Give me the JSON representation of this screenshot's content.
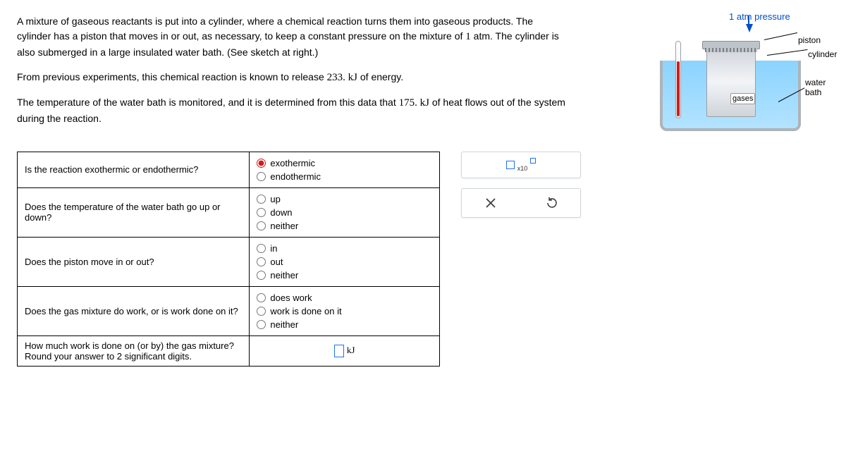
{
  "problem": {
    "p1_a": "A mixture of gaseous reactants is put into a cylinder, where a chemical reaction turns them into gaseous products. The cylinder has a piston that moves in or out, as necessary, to keep a constant pressure on the mixture of ",
    "p1_num": "1",
    "p1_b": " atm. The cylinder is also submerged in a large insulated water bath. (See sketch at right.)",
    "p2_a": "From previous experiments, this chemical reaction is known to release ",
    "p2_num": "233. kJ",
    "p2_b": " of energy.",
    "p3_a": "The temperature of the water bath is monitored, and it is determined from this data that ",
    "p3_num": "175. kJ",
    "p3_b": " of heat flows out of the system during the reaction."
  },
  "sketch_labels": {
    "atm": "1 atm pressure",
    "piston": "piston",
    "cylinder": "cylinder",
    "water_bath": "water bath",
    "gases": "gases"
  },
  "questions": {
    "q1": "Is the reaction exothermic or endothermic?",
    "q1_opts": {
      "a": "exothermic",
      "b": "endothermic"
    },
    "q2": "Does the temperature of the water bath go up or down?",
    "q2_opts": {
      "a": "up",
      "b": "down",
      "c": "neither"
    },
    "q3": "Does the piston move in or out?",
    "q3_opts": {
      "a": "in",
      "b": "out",
      "c": "neither"
    },
    "q4": "Does the gas mixture do work, or is work done on it?",
    "q4_opts": {
      "a": "does work",
      "b": "work is done on it",
      "c": "neither"
    },
    "q5_a": "How much work is done on (or by) the gas mixture? Round your answer to ",
    "q5_num": "2",
    "q5_b": " significant digits.",
    "q5_unit": "kJ"
  },
  "toolbar": {
    "exp_sub": "x10"
  }
}
